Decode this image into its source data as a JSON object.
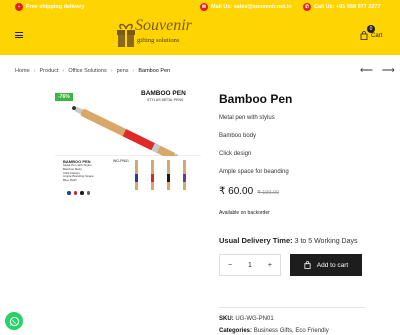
{
  "topbar": {
    "shipping": "Free shipping delivery",
    "mail": "Mail Us: sales@souvenir.net.in",
    "call": "Call Us: +91 958 977 2277"
  },
  "header": {
    "logo_main": "Souvenir",
    "logo_sub": "gifting solutions",
    "cart_label": "Cart",
    "cart_count": "0"
  },
  "breadcrumb": [
    "Home",
    "Product",
    "Office Solutions",
    "pens",
    "Bamboo Pen"
  ],
  "product_image": {
    "discount": "-76%",
    "title": "BAMBOO PEN",
    "subtitle": "STYLUS METAL PENS",
    "detail_title": "BAMBOO PEN",
    "detail_code": "WG-PN01",
    "detail_list": [
      "Metal Pen with Stylus",
      "Bamboo Body",
      "Click Design",
      "Ample Branding Space",
      "Blue Refill"
    ],
    "colors": [
      "#1f3f9a",
      "#d12a2a",
      "#1a1a1a",
      "#666666"
    ]
  },
  "product": {
    "title": "Bamboo Pen",
    "features": [
      "Metal pen with stylus",
      "Bamboo body",
      "Click design",
      "Ample space for beanding"
    ],
    "price": "₹ 60.00",
    "old_price": "₹ 199.00",
    "stock": "Available on backorder",
    "delivery_label": "Usual Delivery Time:",
    "delivery_value": "3 to 5 Working Days",
    "quantity": "1",
    "add_to_cart": "Add to cart",
    "sku_label": "SKU:",
    "sku_value": "UG-WG-PN01",
    "categories_label": "Categories:",
    "categories_value": "Business Gifts, Eco Friendly"
  },
  "colors": {
    "brand_yellow": "#ffd400",
    "button_dark": "#1d1d1d",
    "discount_green": "#3cb543",
    "whatsapp_green": "#25d366"
  }
}
